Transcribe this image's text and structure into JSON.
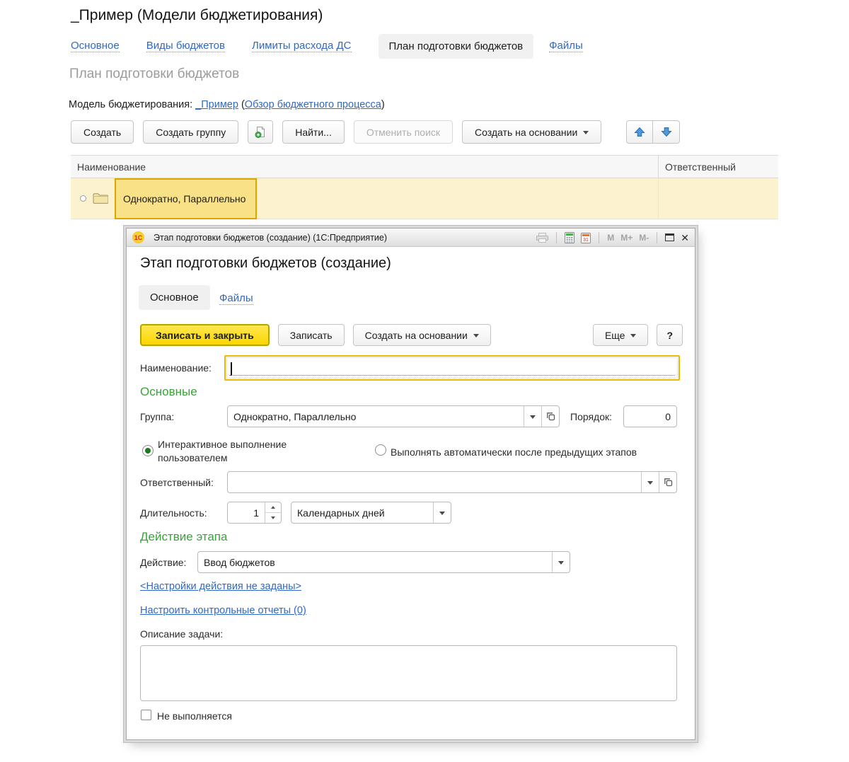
{
  "colors": {
    "link_blue": "#3169c1",
    "section_green": "#3aa33a",
    "selection_yellow_bg": "#f8e187",
    "selection_yellow_border": "#d9a602",
    "row_yellow_bg": "#fcf2cf",
    "primary_button_yellow": "#ffe23a",
    "focus_border_gold": "#edb800"
  },
  "page": {
    "title": "_Пример (Модели бюджетирования)",
    "tabs": [
      {
        "label": "Основное"
      },
      {
        "label": "Виды бюджетов"
      },
      {
        "label": "Лимиты расхода ДС"
      },
      {
        "label": "План подготовки бюджетов"
      },
      {
        "label": "Файлы"
      }
    ],
    "heading": "План подготовки бюджетов",
    "model": {
      "label": "Модель бюджетирования:",
      "name_link": "_Пример",
      "paren_open": "(",
      "overview_link": "Обзор бюджетного процесса",
      "paren_close": ")"
    },
    "toolbar": {
      "create": "Создать",
      "create_group": "Создать группу",
      "find": "Найти...",
      "cancel_search": "Отменить поиск",
      "create_based_on": "Создать на основании"
    },
    "table": {
      "columns": [
        "Наименование",
        "Ответственный"
      ],
      "rows": [
        {
          "name": "Однократно, Параллельно",
          "responsible": ""
        }
      ]
    }
  },
  "dialog": {
    "titlebar": {
      "logo_text": "1С",
      "title": "Этап подготовки бюджетов (создание)  (1С:Предприятие)",
      "calendar_day": "31",
      "m": "M",
      "m_plus": "M+",
      "m_minus": "M-"
    },
    "heading": "Этап подготовки бюджетов (создание)",
    "tabs": [
      {
        "label": "Основное"
      },
      {
        "label": "Файлы"
      }
    ],
    "buttons": {
      "save_and_close": "Записать и закрыть",
      "save": "Записать",
      "create_based_on": "Создать на основании",
      "more": "Еще",
      "help": "?"
    },
    "fields": {
      "name_label": "Наименование:",
      "name_value": "",
      "section_main": "Основные",
      "group_label": "Группа:",
      "group_value": "Однократно, Параллельно",
      "order_label": "Порядок:",
      "order_value": "0",
      "radio_interactive": "Интерактивное выполнение пользователем",
      "radio_automatic": "Выполнять автоматически после предыдущих этапов",
      "responsible_label": "Ответственный:",
      "responsible_value": "",
      "duration_label": "Длительность:",
      "duration_value": "1",
      "duration_unit": "Календарных дней",
      "section_action": "Действие этапа",
      "action_label": "Действие:",
      "action_value": "Ввод бюджетов",
      "action_settings_link": "<Настройки действия не заданы>",
      "control_reports_link": "Настроить контрольные отчеты (0)",
      "description_label": "Описание задачи:",
      "description_value": "",
      "not_executed_label": "Не выполняется"
    }
  }
}
